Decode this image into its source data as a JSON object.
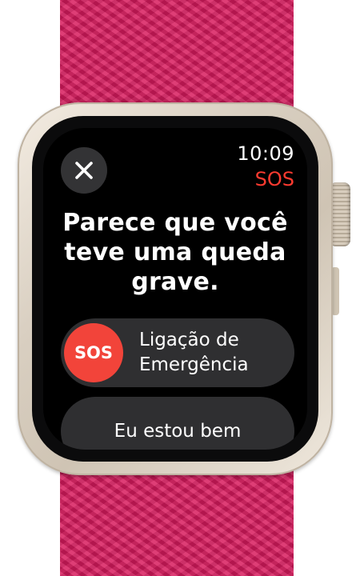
{
  "status": {
    "time": "10:09",
    "mode": "SOS"
  },
  "alert": {
    "message": "Parece que você teve uma queda grave."
  },
  "emergency_slider": {
    "knob_label": "SOS",
    "label": "Ligação de Emergência"
  },
  "ok_button": {
    "label": "Eu estou bem"
  },
  "icons": {
    "close": "close-icon"
  },
  "colors": {
    "sos_red": "#f2443a",
    "sos_text": "#ff3b30",
    "band": "#d81b5e",
    "case": "#d9cfc1"
  }
}
